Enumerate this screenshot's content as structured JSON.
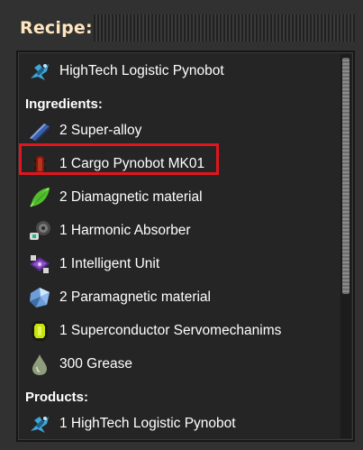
{
  "window": {
    "title": "Recipe:"
  },
  "recipe": {
    "name": "HighTech Logistic Pynobot",
    "icon": "hightech-logistic-pynobot-icon"
  },
  "ingredients_label": "Ingredients:",
  "ingredients": [
    {
      "text": "2 Super-alloy",
      "icon": "super-alloy-icon"
    },
    {
      "text": "1 Cargo Pynobot MK01",
      "icon": "cargo-pynobot-mk01-icon"
    },
    {
      "text": "2 Diamagnetic material",
      "icon": "diamagnetic-material-icon"
    },
    {
      "text": "1 Harmonic Absorber",
      "icon": "harmonic-absorber-icon"
    },
    {
      "text": "1 Intelligent Unit",
      "icon": "intelligent-unit-icon"
    },
    {
      "text": "2 Paramagnetic material",
      "icon": "paramagnetic-material-icon"
    },
    {
      "text": "1 Superconductor Servomechanims",
      "icon": "superconductor-servomechanims-icon"
    },
    {
      "text": "300 Grease",
      "icon": "grease-icon"
    }
  ],
  "products_label": "Products:",
  "products": [
    {
      "text": "1 HighTech Logistic Pynobot",
      "icon": "hightech-logistic-pynobot-icon"
    }
  ],
  "colors": {
    "title": "#ffe6c0",
    "highlight": "#e0151d",
    "panel_bg": "#252525",
    "window_bg": "#313131"
  }
}
